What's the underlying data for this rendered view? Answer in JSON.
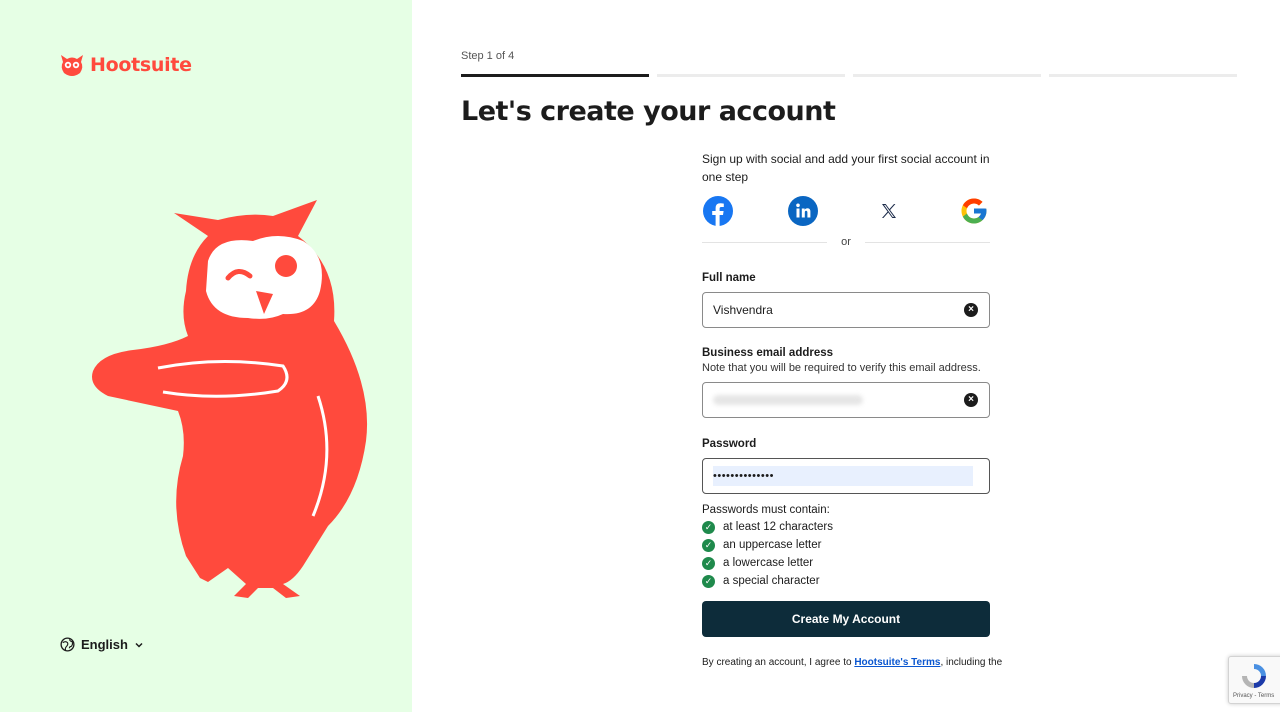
{
  "brand": {
    "name": "Hootsuite",
    "accent": "#ff4a3d",
    "panel_bg": "#e6ffe5"
  },
  "language": {
    "label": "English",
    "icon": "globe-icon"
  },
  "progress": {
    "step_text": "Step 1 of 4",
    "current_step": 1,
    "total_steps": 4
  },
  "title": "Let's create your account",
  "social": {
    "intro": "Sign up with social and add your first social account in one step",
    "providers": [
      "facebook-icon",
      "linkedin-icon",
      "x-icon",
      "google-icon"
    ],
    "divider": "or"
  },
  "full_name": {
    "label": "Full name",
    "value": "Vishvendra"
  },
  "email": {
    "label": "Business email address",
    "hint": "Note that you will be required to verify this email address."
  },
  "password": {
    "label": "Password",
    "masked_value": "••••••••••••••",
    "rules_heading": "Passwords must contain:",
    "rules": [
      "at least 12 characters",
      "an uppercase letter",
      "a lowercase letter",
      "a special character"
    ]
  },
  "submit": {
    "label": "Create My Account",
    "color": "#0d2c3a"
  },
  "legal": {
    "prefix": "By creating an account, I agree to ",
    "link": "Hootsuite's Terms",
    "suffix": ", including the"
  },
  "recaptcha": {
    "terms": "Privacy - Terms"
  }
}
